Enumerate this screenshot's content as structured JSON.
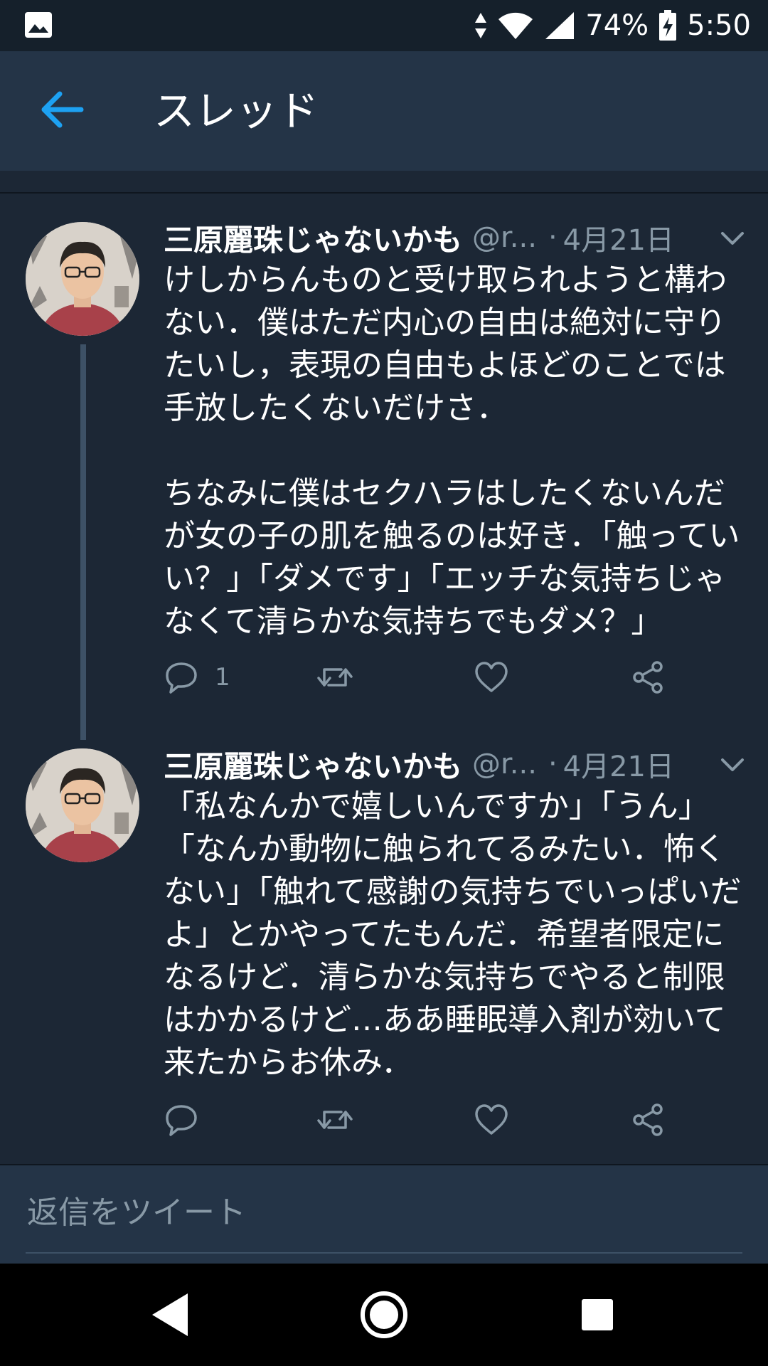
{
  "status_bar": {
    "battery": "74%",
    "time": "5:50",
    "icons": [
      "gallery-icon",
      "data-arrows-icon",
      "wifi-icon",
      "signal-icon",
      "battery-charging-icon"
    ]
  },
  "header": {
    "title": "スレッド",
    "back_icon": "arrow-left-icon"
  },
  "tweets": [
    {
      "name": "三原麗珠じゃないかも",
      "handle": "@r...",
      "date": "4月21日",
      "text": "けしからんものと受け取られようと構わない．僕はただ内心の自由は絶対に守りたいし，表現の自由もよほどのことでは手放したくないだけさ．\n\nちなみに僕はセクハラはしたくないんだが女の子の肌を触るのは好き．「触っていい？」「ダメです」「エッチな気持ちじゃなくて清らかな気持ちでもダメ？」",
      "reply_count": "1"
    },
    {
      "name": "三原麗珠じゃないかも",
      "handle": "@r...",
      "date": "4月21日",
      "text": "「私なんかで嬉しいんですか」「うん」「なんか動物に触られてるみたい．怖くない」「触れて感謝の気持ちでいっぱいだよ」とかやってたもんだ．希望者限定になるけど．清らかな気持ちでやると制限はかかるけど…ああ睡眠導入剤が効いて来たからお休み．",
      "reply_count": ""
    }
  ],
  "reply": {
    "placeholder": "返信をツイート"
  },
  "colors": {
    "background": "#1c2735",
    "app_bar": "#243447",
    "accent": "#1da1f2",
    "secondary_text": "#8899a6"
  }
}
